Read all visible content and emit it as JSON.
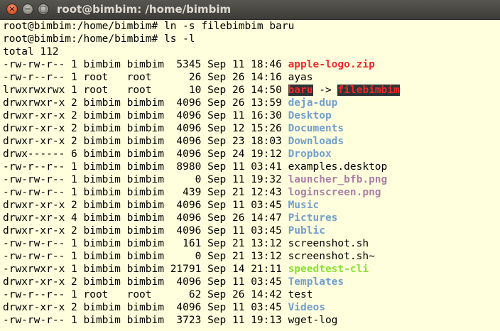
{
  "window": {
    "title": "root@bimbim: /home/bimbim",
    "close_glyph": "×",
    "minimize_glyph": "−",
    "maximize_glyph": "□"
  },
  "terminal": {
    "command_lines": [
      "root@bimbim:/home/bimbim# ln -s filebimbim baru",
      "root@bimbim:/home/bimbim# ls -l"
    ],
    "total_line": "total 112",
    "entries": [
      {
        "perms": "-rw-rw-r--",
        "links": "1",
        "owner": "bimbim",
        "group": "bimbim",
        "size": "5345",
        "date": "Sep 11 18:46",
        "name": "apple-logo.zip",
        "kind": "archive"
      },
      {
        "perms": "-rw-r--r--",
        "links": "1",
        "owner": "root",
        "group": "root",
        "size": "26",
        "date": "Sep 26 14:16",
        "name": "ayas",
        "kind": "regular"
      },
      {
        "perms": "lrwxrwxrwx",
        "links": "1",
        "owner": "root",
        "group": "root",
        "size": "10",
        "date": "Sep 26 14:50",
        "name": "baru",
        "kind": "link",
        "arrow": " -> ",
        "target": "filebimbim"
      },
      {
        "perms": "drwxrwxr-x",
        "links": "2",
        "owner": "bimbim",
        "group": "bimbim",
        "size": "4096",
        "date": "Sep 26 13:59",
        "name": "deja-dup",
        "kind": "dir"
      },
      {
        "perms": "drwxr-xr-x",
        "links": "2",
        "owner": "bimbim",
        "group": "bimbim",
        "size": "4096",
        "date": "Sep 11 16:30",
        "name": "Desktop",
        "kind": "dir"
      },
      {
        "perms": "drwxr-xr-x",
        "links": "2",
        "owner": "bimbim",
        "group": "bimbim",
        "size": "4096",
        "date": "Sep 12 15:26",
        "name": "Documents",
        "kind": "dir"
      },
      {
        "perms": "drwxr-xr-x",
        "links": "2",
        "owner": "bimbim",
        "group": "bimbim",
        "size": "4096",
        "date": "Sep 23 18:03",
        "name": "Downloads",
        "kind": "dir"
      },
      {
        "perms": "drwx------",
        "links": "6",
        "owner": "bimbim",
        "group": "bimbim",
        "size": "4096",
        "date": "Sep 24 19:12",
        "name": "Dropbox",
        "kind": "dir"
      },
      {
        "perms": "-rw-r--r--",
        "links": "1",
        "owner": "bimbim",
        "group": "bimbim",
        "size": "8980",
        "date": "Sep 11 03:41",
        "name": "examples.desktop",
        "kind": "regular"
      },
      {
        "perms": "-rw-rw-r--",
        "links": "1",
        "owner": "bimbim",
        "group": "bimbim",
        "size": "0",
        "date": "Sep 11 19:32",
        "name": "launcher_bfb.png",
        "kind": "image"
      },
      {
        "perms": "-rw-rw-r--",
        "links": "1",
        "owner": "bimbim",
        "group": "bimbim",
        "size": "439",
        "date": "Sep 21 12:43",
        "name": "loginscreen.png",
        "kind": "image"
      },
      {
        "perms": "drwxr-xr-x",
        "links": "2",
        "owner": "bimbim",
        "group": "bimbim",
        "size": "4096",
        "date": "Sep 11 03:45",
        "name": "Music",
        "kind": "dir"
      },
      {
        "perms": "drwxr-xr-x",
        "links": "4",
        "owner": "bimbim",
        "group": "bimbim",
        "size": "4096",
        "date": "Sep 26 14:47",
        "name": "Pictures",
        "kind": "dir"
      },
      {
        "perms": "drwxr-xr-x",
        "links": "2",
        "owner": "bimbim",
        "group": "bimbim",
        "size": "4096",
        "date": "Sep 11 03:45",
        "name": "Public",
        "kind": "dir"
      },
      {
        "perms": "-rw-rw-r--",
        "links": "1",
        "owner": "bimbim",
        "group": "bimbim",
        "size": "161",
        "date": "Sep 21 13:12",
        "name": "screenshot.sh",
        "kind": "regular"
      },
      {
        "perms": "-rw-rw-r--",
        "links": "1",
        "owner": "bimbim",
        "group": "bimbim",
        "size": "0",
        "date": "Sep 21 13:12",
        "name": "screenshot.sh~",
        "kind": "regular"
      },
      {
        "perms": "-rwxrwxr-x",
        "links": "1",
        "owner": "bimbim",
        "group": "bimbim",
        "size": "21791",
        "date": "Sep 14 21:11",
        "name": "speedtest-cli",
        "kind": "exec"
      },
      {
        "perms": "drwxr-xr-x",
        "links": "2",
        "owner": "bimbim",
        "group": "bimbim",
        "size": "4096",
        "date": "Sep 11 03:45",
        "name": "Templates",
        "kind": "dir"
      },
      {
        "perms": "-rw-r--r--",
        "links": "1",
        "owner": "root",
        "group": "root",
        "size": "62",
        "date": "Sep 26 14:42",
        "name": "test",
        "kind": "regular"
      },
      {
        "perms": "drwxr-xr-x",
        "links": "2",
        "owner": "bimbim",
        "group": "bimbim",
        "size": "4096",
        "date": "Sep 11 03:45",
        "name": "Videos",
        "kind": "dir"
      },
      {
        "perms": "-rw-rw-r--",
        "links": "1",
        "owner": "bimbim",
        "group": "bimbim",
        "size": "3723",
        "date": "Sep 11 19:13",
        "name": "wget-log",
        "kind": "regular"
      }
    ]
  },
  "colors": {
    "terminal_background": "#ffffdd",
    "archive": "#ef2929",
    "directory": "#729fcf",
    "image": "#ad7fa8",
    "executable": "#8ae234",
    "symlink_background": "#2e3436",
    "symlink_text": "#ef2929",
    "titlebar": "#3c3b37",
    "close_button": "#e15a26"
  }
}
